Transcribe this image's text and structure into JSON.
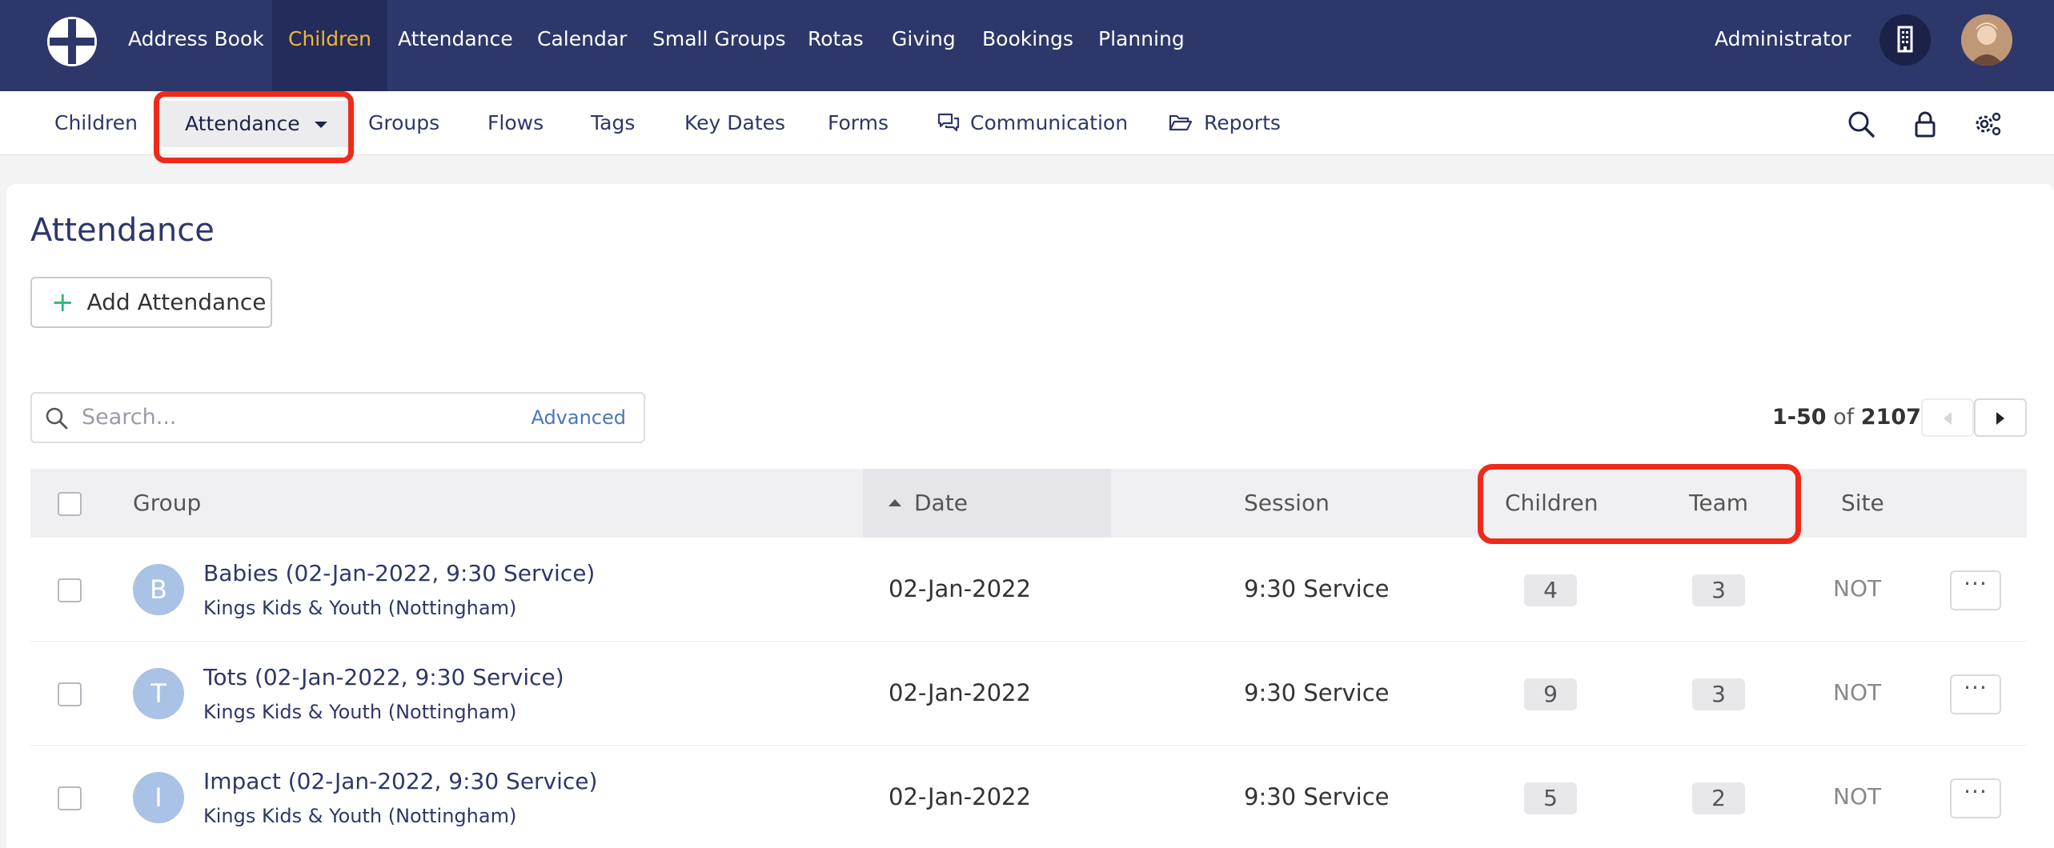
{
  "top_nav": {
    "logo_icon": "church-cross-logo-icon",
    "items": [
      "Address Book",
      "Children",
      "Attendance",
      "Calendar",
      "Small Groups",
      "Rotas",
      "Giving",
      "Bookings",
      "Planning"
    ],
    "active": "Children",
    "user": "Administrator",
    "building_icon": "building-icon",
    "avatar_icon": "user-avatar"
  },
  "sub_nav": {
    "items": [
      "Children",
      "Attendance",
      "Groups",
      "Flows",
      "Tags",
      "Key Dates",
      "Forms",
      "Communication",
      "Reports"
    ],
    "active": "Attendance",
    "icons": [
      "search-icon",
      "lock-icon",
      "settings-icon"
    ]
  },
  "page": {
    "title": "Attendance",
    "add_button": "Add Attendance",
    "search": {
      "placeholder": "Search...",
      "advanced": "Advanced"
    },
    "pager": {
      "range": "1-50",
      "of": "of",
      "total": "2107"
    }
  },
  "table": {
    "headers": {
      "group": "Group",
      "date": "Date",
      "session": "Session",
      "children": "Children",
      "team": "Team",
      "site": "Site"
    },
    "rows": [
      {
        "initial": "B",
        "title": "Babies (02-Jan-2022, 9:30 Service)",
        "org": "Kings Kids & Youth (Nottingham)",
        "date": "02-Jan-2022",
        "session": "9:30 Service",
        "children": "4",
        "team": "3",
        "site": "NOT"
      },
      {
        "initial": "T",
        "title": "Tots (02-Jan-2022, 9:30 Service)",
        "org": "Kings Kids & Youth (Nottingham)",
        "date": "02-Jan-2022",
        "session": "9:30 Service",
        "children": "9",
        "team": "3",
        "site": "NOT"
      },
      {
        "initial": "I",
        "title": "Impact (02-Jan-2022, 9:30 Service)",
        "org": "Kings Kids & Youth (Nottingham)",
        "date": "02-Jan-2022",
        "session": "9:30 Service",
        "children": "5",
        "team": "2",
        "site": "NOT"
      }
    ],
    "row_action": "···"
  },
  "colors": {
    "nav_bg": "#2d3769",
    "active_text": "#f2b53a",
    "highlight": "#ee2a1a",
    "add_icon": "#36b37e"
  }
}
